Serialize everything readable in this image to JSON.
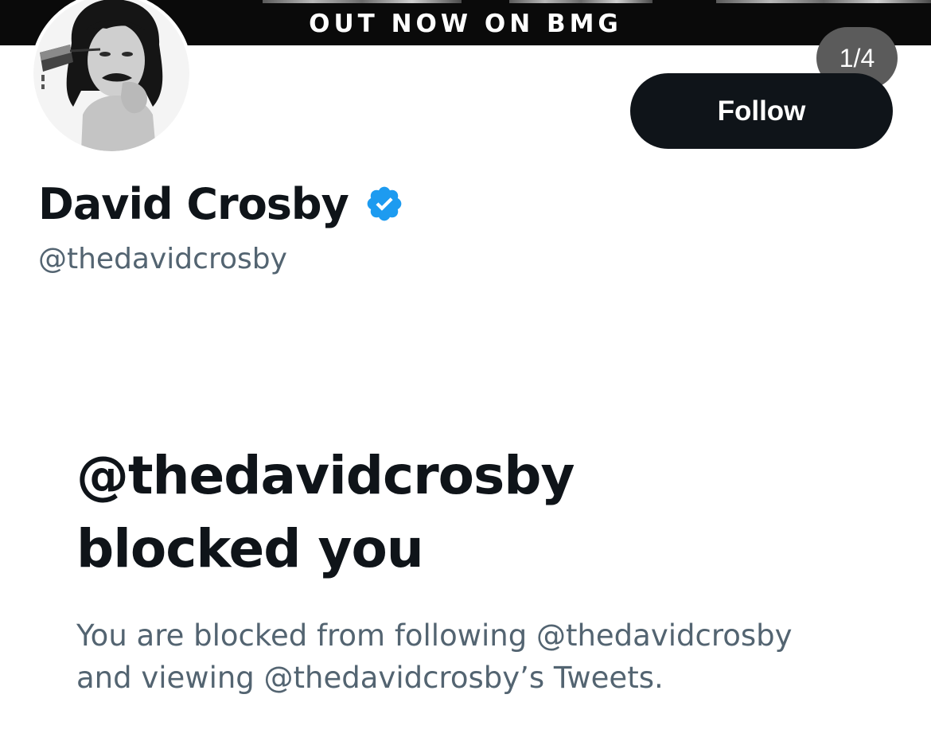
{
  "banner": {
    "text": "OUT NOW ON BMG"
  },
  "profile": {
    "display_name": "David Crosby",
    "handle": "@thedavidcrosby",
    "verified": true,
    "avatar_icon": "profile-photo"
  },
  "pager": {
    "label": "1/4"
  },
  "actions": {
    "follow_label": "Follow"
  },
  "blocked_notice": {
    "title_line1": "@thedavidcrosby",
    "title_line2": "blocked you",
    "desc_line1": "You are blocked from following @thedavidcrosby",
    "desc_line2": "and viewing @thedavidcrosby’s Tweets."
  },
  "colors": {
    "verified_blue": "#1d9bf0",
    "primary_text": "#0f1419",
    "secondary_text": "#536471",
    "follow_button_bg": "#0f1419",
    "pager_bg": "#5b5b5b"
  }
}
